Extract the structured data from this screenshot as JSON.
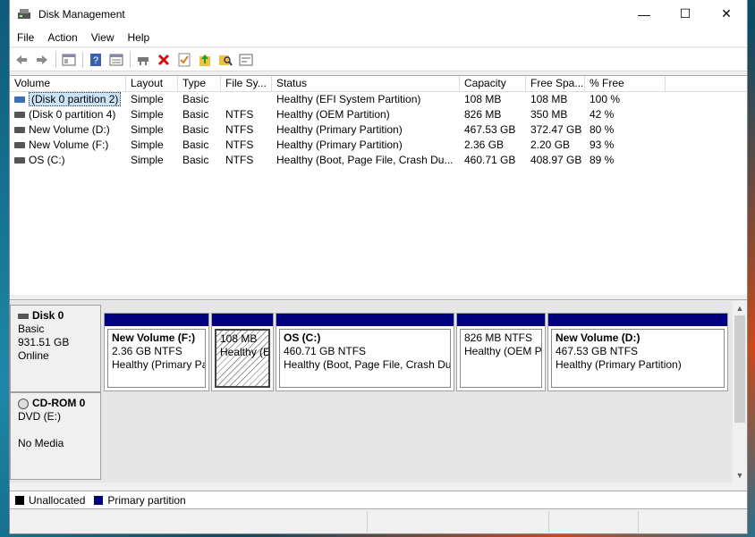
{
  "window": {
    "title": "Disk Management",
    "controls": {
      "minimize": "—",
      "maximize": "☐",
      "close": "✕"
    }
  },
  "menu": [
    "File",
    "Action",
    "View",
    "Help"
  ],
  "toolbar": [
    "back-arrow-icon",
    "forward-arrow-icon",
    "console-icon",
    "help-icon",
    "list-icon",
    "connect-icon",
    "delete-icon",
    "properties-icon",
    "up-folder-icon",
    "search-icon",
    "settings-icon"
  ],
  "volume_list": {
    "columns": [
      "Volume",
      "Layout",
      "Type",
      "File Sy...",
      "Status",
      "Capacity",
      "Free Spa...",
      "% Free"
    ],
    "rows": [
      [
        "(Disk 0 partition 2)",
        "Simple",
        "Basic",
        "",
        "Healthy (EFI System Partition)",
        "108 MB",
        "108 MB",
        "100 %"
      ],
      [
        "(Disk 0 partition 4)",
        "Simple",
        "Basic",
        "NTFS",
        "Healthy (OEM Partition)",
        "826 MB",
        "350 MB",
        "42 %"
      ],
      [
        "New Volume (D:)",
        "Simple",
        "Basic",
        "NTFS",
        "Healthy (Primary Partition)",
        "467.53 GB",
        "372.47 GB",
        "80 %"
      ],
      [
        "New Volume (F:)",
        "Simple",
        "Basic",
        "NTFS",
        "Healthy (Primary Partition)",
        "2.36 GB",
        "2.20 GB",
        "93 %"
      ],
      [
        "OS (C:)",
        "Simple",
        "Basic",
        "NTFS",
        "Healthy (Boot, Page File, Crash Du...",
        "460.71 GB",
        "408.97 GB",
        "89 %"
      ]
    ]
  },
  "disks": {
    "disk0": {
      "name": "Disk 0",
      "type": "Basic",
      "size": "931.51 GB",
      "status": "Online",
      "partitions": [
        {
          "name": "New Volume  (F:)",
          "size": "2.36 GB NTFS",
          "status": "Healthy (Primary Pa"
        },
        {
          "name": "",
          "size": "108 MB",
          "status": "Healthy (EI"
        },
        {
          "name": "OS  (C:)",
          "size": "460.71 GB NTFS",
          "status": "Healthy (Boot, Page File, Crash Dur"
        },
        {
          "name": "",
          "size": "826 MB NTFS",
          "status": "Healthy (OEM Pa"
        },
        {
          "name": "New Volume  (D:)",
          "size": "467.53 GB NTFS",
          "status": "Healthy (Primary Partition)"
        }
      ]
    },
    "cdrom0": {
      "name": "CD-ROM 0",
      "type": "DVD (E:)",
      "status": "No Media"
    }
  },
  "legend": {
    "unallocated": {
      "label": "Unallocated",
      "color": "#000000"
    },
    "primary": {
      "label": "Primary partition",
      "color": "#00007f"
    }
  }
}
